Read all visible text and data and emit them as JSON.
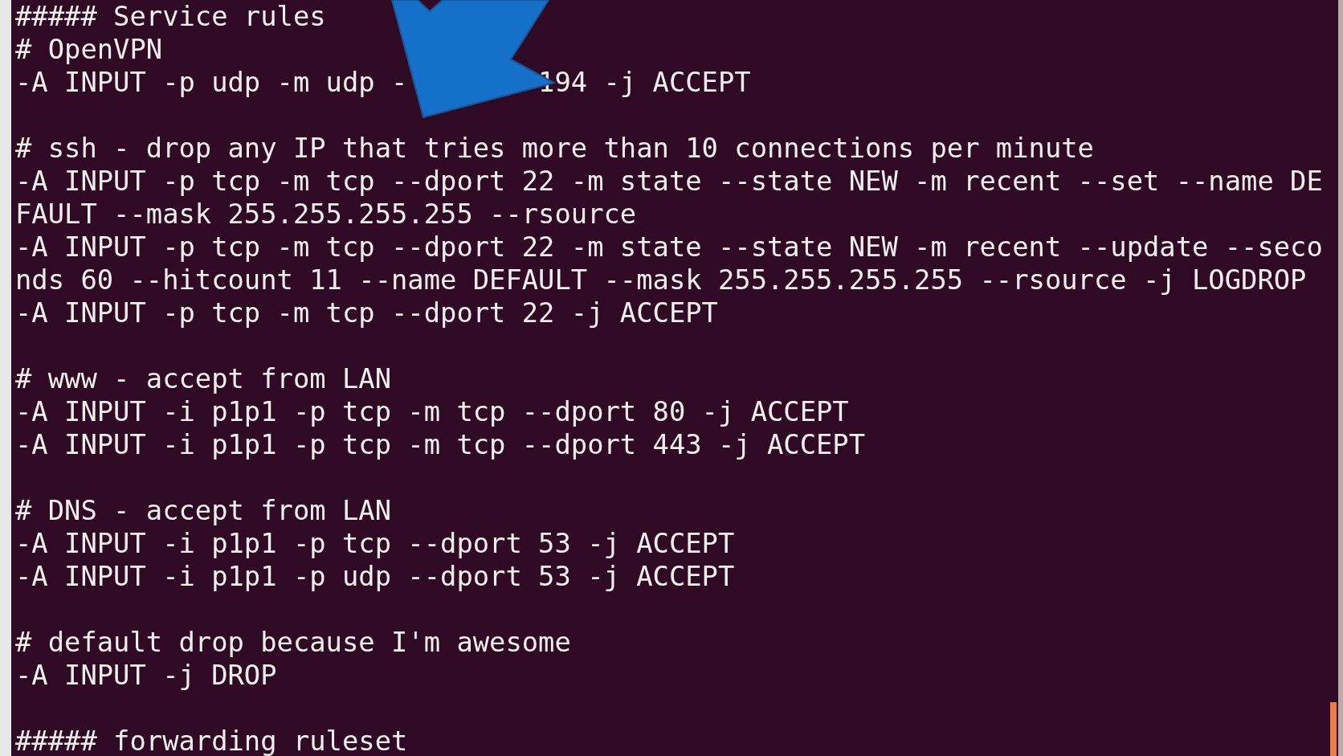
{
  "terminal": {
    "blocks": [
      {
        "lines": [
          {
            "kind": "plain",
            "text": "##### Service rules"
          },
          {
            "kind": "plain",
            "text": "# OpenVPN"
          },
          {
            "kind": "covered",
            "left": "-A INPUT -p udp -m udp -",
            "right": "194 -j ACCEPT"
          }
        ]
      },
      {
        "lines": [
          {
            "kind": "plain",
            "text": "# ssh - drop any IP that tries more than 10 connections per minute"
          },
          {
            "kind": "plain",
            "text": "-A INPUT -p tcp -m tcp --dport 22 -m state --state NEW -m recent --set --name DE"
          },
          {
            "kind": "plain",
            "text": "FAULT --mask 255.255.255.255 --rsource"
          },
          {
            "kind": "plain",
            "text": "-A INPUT -p tcp -m tcp --dport 22 -m state --state NEW -m recent --update --seco"
          },
          {
            "kind": "plain",
            "text": "nds 60 --hitcount 11 --name DEFAULT --mask 255.255.255.255 --rsource -j LOGDROP"
          },
          {
            "kind": "plain",
            "text": "-A INPUT -p tcp -m tcp --dport 22 -j ACCEPT"
          }
        ]
      },
      {
        "lines": [
          {
            "kind": "plain",
            "text": "# www - accept from LAN"
          },
          {
            "kind": "plain",
            "text": "-A INPUT -i p1p1 -p tcp -m tcp --dport 80 -j ACCEPT"
          },
          {
            "kind": "plain",
            "text": "-A INPUT -i p1p1 -p tcp -m tcp --dport 443 -j ACCEPT"
          }
        ]
      },
      {
        "lines": [
          {
            "kind": "plain",
            "text": "# DNS - accept from LAN"
          },
          {
            "kind": "plain",
            "text": "-A INPUT -i p1p1 -p tcp --dport 53 -j ACCEPT"
          },
          {
            "kind": "plain",
            "text": "-A INPUT -i p1p1 -p udp --dport 53 -j ACCEPT"
          }
        ]
      },
      {
        "lines": [
          {
            "kind": "plain",
            "text": "# default drop because I'm awesome"
          },
          {
            "kind": "plain",
            "text": "-A INPUT -j DROP"
          }
        ]
      },
      {
        "lines": [
          {
            "kind": "plain",
            "text": "##### forwarding ruleset"
          }
        ]
      }
    ]
  }
}
